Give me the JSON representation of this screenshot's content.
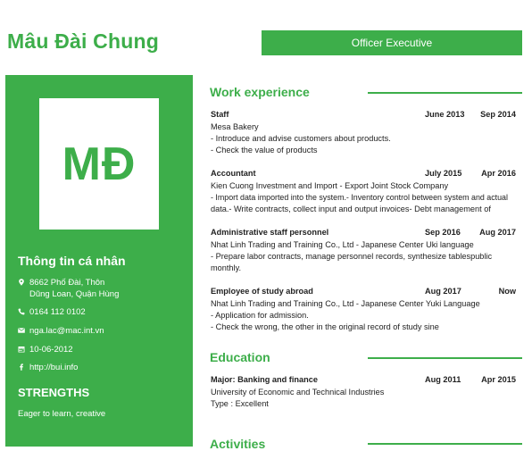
{
  "header": {
    "name": "Mâu Đài Chung",
    "job_title": "Officer Executive"
  },
  "sidebar": {
    "initials": "MĐ",
    "personal_heading": "Thông tin cá nhân",
    "address_line1": "8662 Phố Đài, Thôn",
    "address_line2": "Dũng Loan, Quận Hùng",
    "phone": "0164 112 0102",
    "email": "nga.lac@mac.int.vn",
    "birthdate": "10-06-2012",
    "website": "http://bui.info",
    "strengths_heading": "STRENGTHS",
    "strengths_text": "Eager to learn, creative"
  },
  "sections": {
    "work_title": "Work experience",
    "education_title": "Education",
    "activities_title": "Activities"
  },
  "work": [
    {
      "role": "Staff",
      "start": "June 2013",
      "end": "Sep 2014",
      "company": "Mesa Bakery",
      "lines": [
        "- Introduce and advise customers about products.",
        "- Check the value of products"
      ]
    },
    {
      "role": "Accountant",
      "start": "July 2015",
      "end": "Apr 2016",
      "company": "Kien Cuong Investment and Import - Export Joint Stock Company",
      "lines": [
        "- Import data imported into the system.- Inventory control between system and actual",
        "data.- Write contracts, collect input and output invoices- Debt management of"
      ]
    },
    {
      "role": "Administrative staff personnel",
      "start": "Sep 2016",
      "end": "Aug 2017",
      "company": "Nhat Linh Trading and Training Co., Ltd - Japanese Center Uki language",
      "lines": [
        "- Prepare labor contracts, manage personnel records, synthesize tablespublic",
        "monthly."
      ]
    },
    {
      "role": "Employee of study abroad",
      "start": "Aug 2017",
      "end": "Now",
      "company": "Nhat Linh Trading and Training Co., Ltd - Japanese Center Yuki Language",
      "lines": [
        "- Application for admission.",
        "- Check the wrong, the other in the original record of study sine"
      ]
    }
  ],
  "education": [
    {
      "role": "Major: Banking and finance",
      "start": "Aug 2011",
      "end": "Apr 2015",
      "company": "University of Economic and Technical Industries",
      "lines": [
        "Type : Excellent"
      ]
    }
  ],
  "colors": {
    "accent": "#3dae4a",
    "text": "#222222",
    "background": "#ffffff"
  },
  "icons": [
    "map-marker-icon",
    "phone-icon",
    "envelope-icon",
    "calendar-icon",
    "facebook-icon"
  ]
}
